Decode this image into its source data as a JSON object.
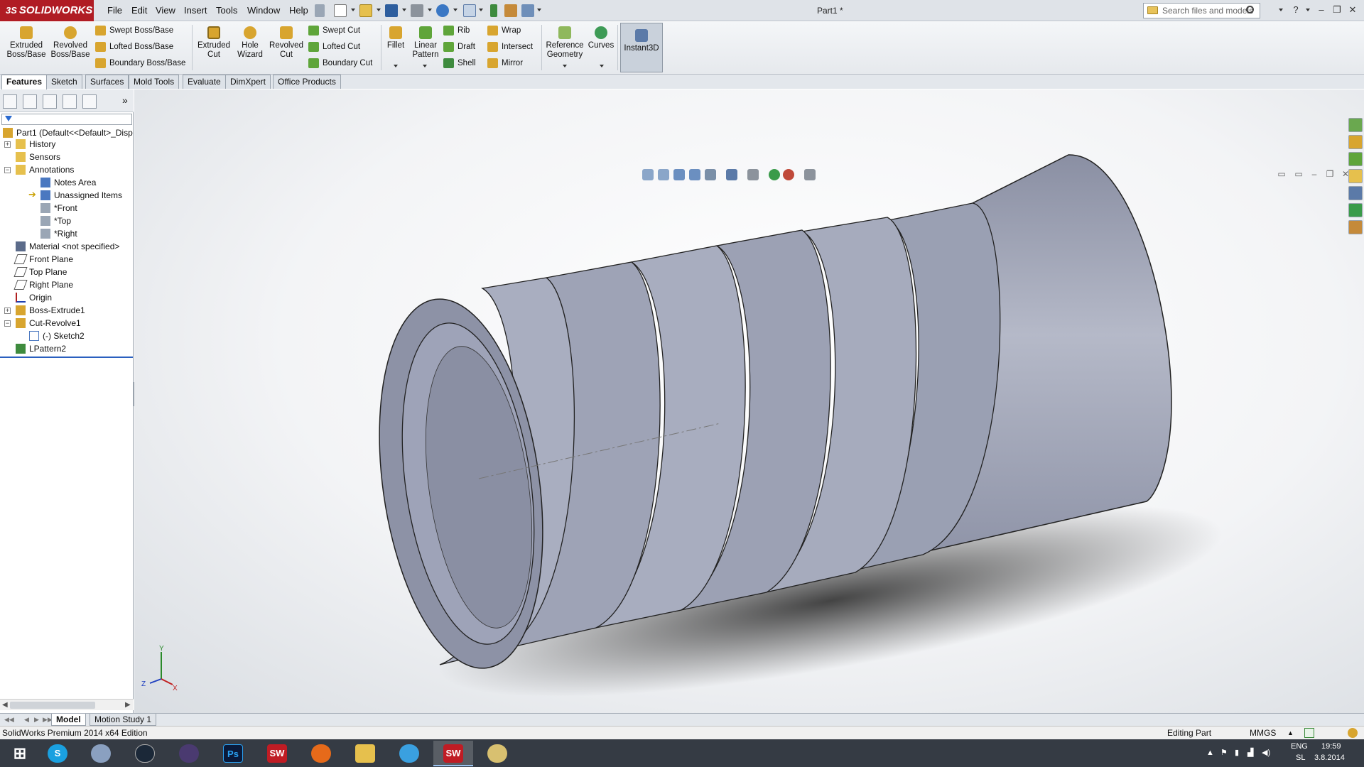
{
  "app": {
    "brand": "SOLIDWORKS",
    "brand_prefix": "3S",
    "doc_title": "Part1 *"
  },
  "menu": [
    "File",
    "Edit",
    "View",
    "Insert",
    "Tools",
    "Window",
    "Help"
  ],
  "search": {
    "placeholder": "Search files and models"
  },
  "ribbon": {
    "extruded_boss": "Extruded Boss/Base",
    "revolved_boss": "Revolved Boss/Base",
    "swept_boss": "Swept Boss/Base",
    "lofted_boss": "Lofted Boss/Base",
    "boundary_boss": "Boundary Boss/Base",
    "extruded_cut": "Extruded Cut",
    "hole_wizard": "Hole Wizard",
    "revolved_cut": "Revolved Cut",
    "swept_cut": "Swept Cut",
    "lofted_cut": "Lofted Cut",
    "boundary_cut": "Boundary Cut",
    "fillet": "Fillet",
    "linear_pattern": "Linear Pattern",
    "rib": "Rib",
    "draft": "Draft",
    "shell": "Shell",
    "wrap": "Wrap",
    "intersect": "Intersect",
    "mirror": "Mirror",
    "reference_geometry": "Reference Geometry",
    "curves": "Curves",
    "instant3d": "Instant3D"
  },
  "tabs": [
    "Features",
    "Sketch",
    "Surfaces",
    "Mold Tools",
    "Evaluate",
    "DimXpert",
    "Office Products"
  ],
  "tree": {
    "root": "Part1  (Default<<Default>_Disp",
    "history": "History",
    "sensors": "Sensors",
    "annotations": "Annotations",
    "notes_area": "Notes Area",
    "unassigned": "Unassigned Items",
    "front_view": "*Front",
    "top_view": "*Top",
    "right_view": "*Right",
    "material": "Material <not specified>",
    "front_plane": "Front Plane",
    "top_plane": "Top Plane",
    "right_plane": "Right Plane",
    "origin": "Origin",
    "boss_extrude": "Boss-Extrude1",
    "cut_revolve": "Cut-Revolve1",
    "sketch2": "(-) Sketch2",
    "lpattern": "LPattern2"
  },
  "triad": {
    "x": "X",
    "y": "Y",
    "z": "Z"
  },
  "bottom_tabs": [
    "Model",
    "Motion Study 1"
  ],
  "status": {
    "edition": "SolidWorks Premium 2014 x64 Edition",
    "mode": "Editing Part",
    "units": "MMGS"
  },
  "taskbar": {
    "lang": "ENG",
    "locale": "SL",
    "time": "19:59",
    "date": "3.8.2014",
    "sw_label": "SW",
    "ps_label": "Ps"
  },
  "colors": {
    "brand_red": "#b01c24",
    "part_grey": "#9aa0b2",
    "selection_blue": "#2a5fbf",
    "taskbar": "#353b44"
  }
}
